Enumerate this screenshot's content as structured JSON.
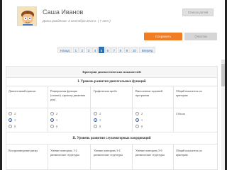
{
  "profile": {
    "name": "Саша Иванов",
    "dob": "Дата рождения: 4 сентября 2014 г. ( 7 лет )",
    "list_button": "Список детей",
    "save_button": "Сохранить",
    "clear_button": "Очистка"
  },
  "pagination": {
    "prev": "Назад",
    "pages": [
      "1",
      "2",
      "3",
      "4",
      "5",
      "6",
      "7",
      "8",
      "9",
      "10"
    ],
    "active": "5",
    "next": "Вперёд"
  },
  "table": {
    "caption": "Критерии диагностических показателей",
    "section1": {
      "title": "I. Уровень развития двигательных функций",
      "headers": [
        "Двигательный праксис",
        "Реципрокная функция (сжатие), характер движения рук)",
        "Графическая проба",
        "Выполнение заданной программы",
        "Общий показатель по критерию"
      ],
      "options": [
        "2",
        "1",
        "0"
      ],
      "selected": [
        "1",
        "1",
        "1",
        "1"
      ],
      "total": "4 балла"
    },
    "section2": {
      "title": "II. Уровень развития слухомоторных координаций",
      "headers": [
        "Воспроизведение ритма",
        "Умение повторить 1-2 ритмические структуры",
        "Умение повторить 3-4 ритмические структуры",
        "Умение повторить 5-6 ритмические структуры",
        "Общий показатель по критерию"
      ]
    }
  }
}
